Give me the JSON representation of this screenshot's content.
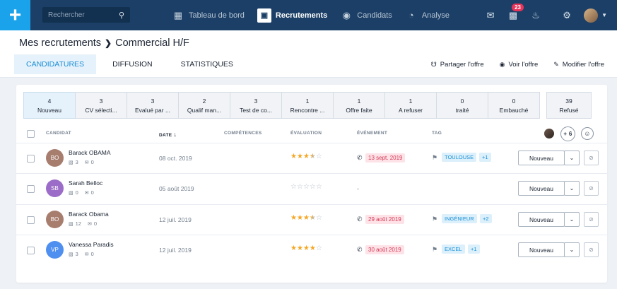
{
  "topbar": {
    "search_placeholder": "Rechercher",
    "nav": [
      {
        "label": "Tableau de bord",
        "icon": "grid-icon"
      },
      {
        "label": "Recrutements",
        "icon": "briefcase-icon"
      },
      {
        "label": "Candidats",
        "icon": "globe-icon"
      },
      {
        "label": "Analyse",
        "icon": "gauge-icon"
      }
    ],
    "notification_count": "23"
  },
  "header": {
    "breadcrumb_parent": "Mes recrutements",
    "breadcrumb_current": "Commercial H/F",
    "tabs": [
      "CANDIDATURES",
      "DIFFUSION",
      "STATISTIQUES"
    ],
    "actions": [
      "Partager l'offre",
      "Voir l'offre",
      "Modifier l'offre"
    ]
  },
  "stages": [
    {
      "count": "4",
      "label": "Nouveau"
    },
    {
      "count": "3",
      "label": "CV sélecti..."
    },
    {
      "count": "3",
      "label": "Evalué par ..."
    },
    {
      "count": "2",
      "label": "Qualif man..."
    },
    {
      "count": "3",
      "label": "Test de co..."
    },
    {
      "count": "1",
      "label": "Rencontre ..."
    },
    {
      "count": "1",
      "label": "Offre faite"
    },
    {
      "count": "1",
      "label": "A refuser"
    },
    {
      "count": "0",
      "label": "traité"
    },
    {
      "count": "0",
      "label": "Embauché"
    },
    {
      "count": "39",
      "label": "Refusé"
    }
  ],
  "columns": {
    "candidat": "CANDIDAT",
    "date": "DATE",
    "competences": "COMPÉTENCES",
    "evaluation": "ÉVALUATION",
    "evenement": "ÉVÉNEMENT",
    "tag": "TAG",
    "more_members": "+ 6"
  },
  "rows": [
    {
      "initials": "BO",
      "avatar_color": "#a77d6e",
      "name": "Barack OBAMA",
      "messages": "3",
      "emails": "0",
      "date": "08 oct. 2019",
      "rating": 3.5,
      "event": "13 sept. 2019",
      "tag": "TOULOUSE",
      "tag_more": "+1",
      "status": "Nouveau"
    },
    {
      "initials": "SB",
      "avatar_color": "#9b6cc8",
      "name": "Sarah Belloc",
      "messages": "0",
      "emails": "0",
      "date": "05 août 2019",
      "rating": 0,
      "event": "-",
      "tag": "",
      "tag_more": "",
      "status": "Nouveau"
    },
    {
      "initials": "BO",
      "avatar_color": "#a77d6e",
      "name": "Barack Obama",
      "messages": "12",
      "emails": "0",
      "date": "12 juil. 2019",
      "rating": 3.5,
      "event": "29 août 2019",
      "tag": "INGÉNIEUR",
      "tag_more": "+2",
      "status": "Nouveau"
    },
    {
      "initials": "VP",
      "avatar_color": "#4f8ff0",
      "name": "Vanessa Paradis",
      "messages": "3",
      "emails": "0",
      "date": "12 juil. 2019",
      "rating": 4,
      "event": "30 août 2019",
      "tag": "EXCEL",
      "tag_more": "+1",
      "status": "Nouveau"
    }
  ]
}
